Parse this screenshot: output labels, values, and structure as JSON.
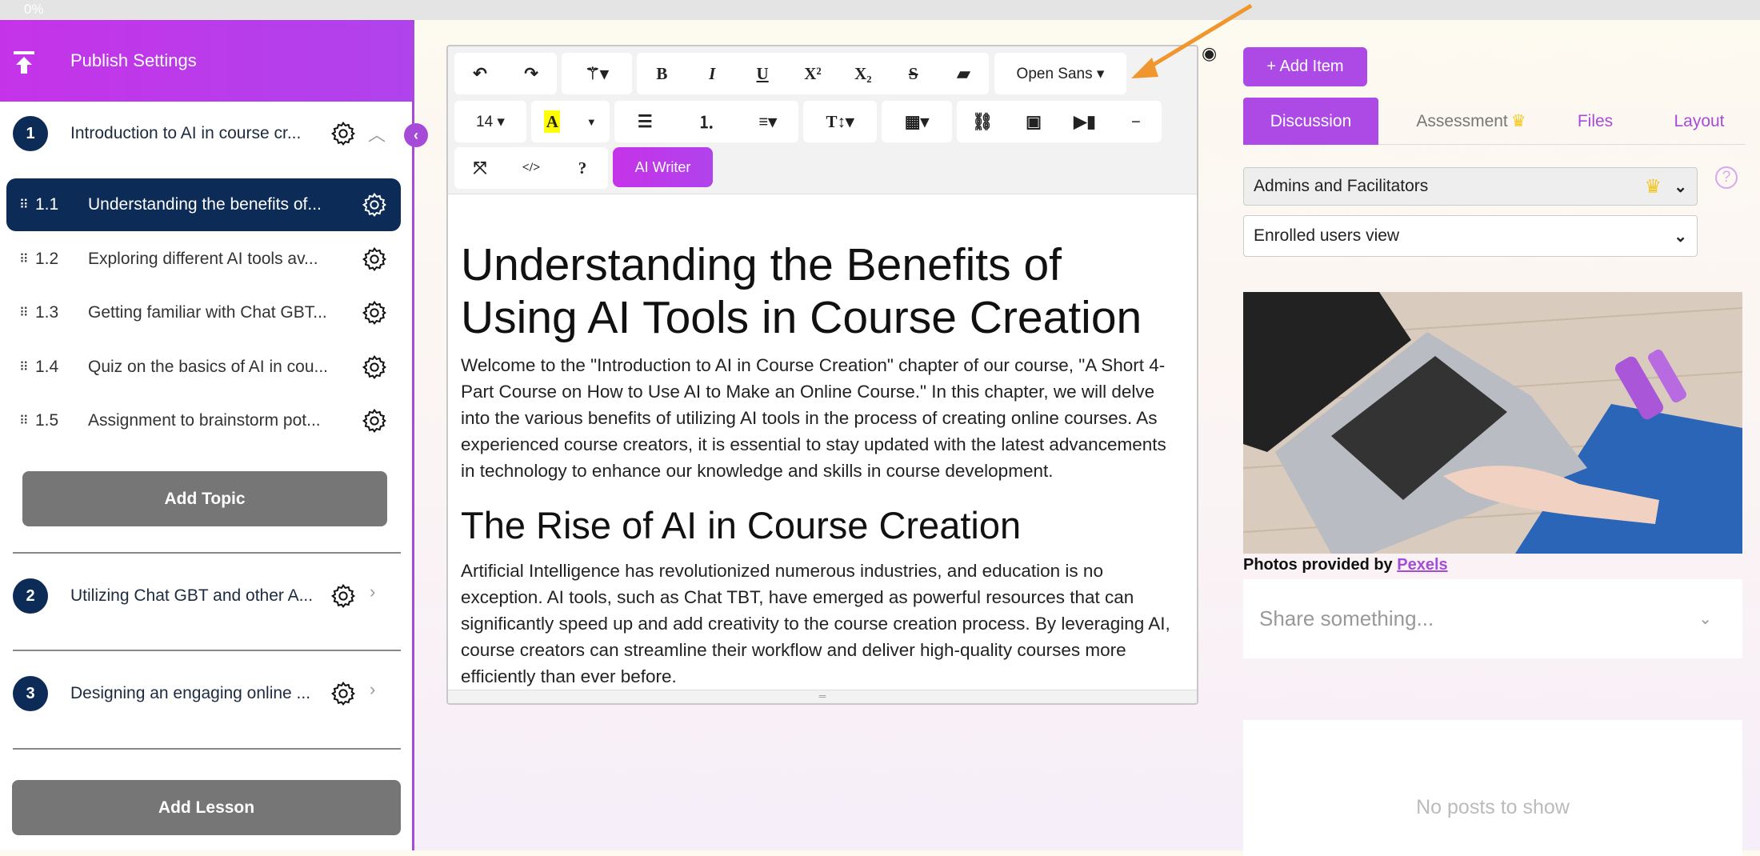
{
  "progress": {
    "label": "0%"
  },
  "sidebar": {
    "publish_label": "Publish Settings",
    "chapters": [
      {
        "num": "1",
        "title": "Introduction to AI in course cr...",
        "expanded": true
      },
      {
        "num": "2",
        "title": "Utilizing Chat GBT and other A...",
        "expanded": false
      },
      {
        "num": "3",
        "title": "Designing an engaging online ...",
        "expanded": false
      }
    ],
    "topics": [
      {
        "num": "1.1",
        "title": "Understanding the benefits of...",
        "selected": true
      },
      {
        "num": "1.2",
        "title": "Exploring different AI tools av..."
      },
      {
        "num": "1.3",
        "title": "Getting familiar with Chat GBT..."
      },
      {
        "num": "1.4",
        "title": "Quiz on the basics of AI in cou..."
      },
      {
        "num": "1.5",
        "title": "Assignment to brainstorm pot..."
      }
    ],
    "add_topic": "Add Topic",
    "add_lesson": "Add Lesson"
  },
  "editor": {
    "toolbar": {
      "font": "Open Sans ▾",
      "size": "14 ▾",
      "ai_writer": "AI Writer",
      "highlight_color": "#ffff00"
    },
    "h1": "Understanding the Benefits of Using AI Tools in Course Creation",
    "p1": "Welcome to the \"Introduction to AI in Course Creation\" chapter of our course, \"A Short 4-Part Course on How to Use AI to Make an Online Course.\" In this chapter, we will delve into the various benefits of utilizing AI tools in the process of creating online courses. As experienced course creators, it is essential to stay updated with the latest advancements in technology to enhance our knowledge and skills in course development.",
    "h2": "The Rise of AI in Course Creation",
    "p2": "Artificial Intelligence has revolutionized numerous industries, and education is no exception. AI tools, such as Chat TBT, have emerged as powerful resources that can significantly speed up and add creativity to the course creation process. By leveraging AI, course creators can streamline their workflow and deliver high-quality courses more efficiently than ever before."
  },
  "right": {
    "add_item": "+ Add Item",
    "tabs": [
      {
        "label": "Discussion",
        "active": true
      },
      {
        "label": "Assessment",
        "premium": true
      },
      {
        "label": "Files"
      },
      {
        "label": "Layout"
      }
    ],
    "audience_select": "Admins and Facilitators",
    "view_select": "Enrolled users view",
    "photo_credit": "Photos provided by",
    "photo_link": "Pexels",
    "share_placeholder": "Share something...",
    "no_posts": "No posts to show"
  },
  "colors": {
    "accent": "#ad4ae6",
    "navy": "#0c2b57",
    "arrow": "#f0962e",
    "crown": "#f5c518"
  }
}
